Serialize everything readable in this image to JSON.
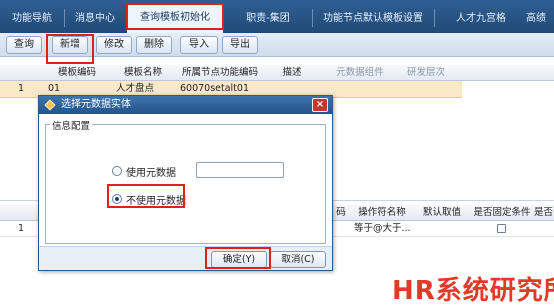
{
  "tabs": [
    "功能导航",
    "消息中心",
    "查询模板初始化",
    "职责-集团",
    "功能节点默认模板设置",
    "人才九宫格",
    "高绩"
  ],
  "toolbar": {
    "query": "查询",
    "add": "新增",
    "edit": "修改",
    "delete": "删除",
    "import": "导入",
    "export": "导出"
  },
  "grid1": {
    "headers": [
      "模板编码",
      "模板名称",
      "所属节点功能编码",
      "描述",
      "元数据组件",
      "研发层次"
    ],
    "row": {
      "num": "1",
      "code": "01",
      "name": "人才盘点",
      "node": "60070setalt01"
    }
  },
  "grid2": {
    "headers": [
      "码",
      "操作符名称",
      "默认取值",
      "是否固定条件",
      "是否..."
    ],
    "row": {
      "num": "1",
      "op": "等于@大于..."
    }
  },
  "dialog": {
    "title": "选择元数据实体",
    "legend": "信息配置",
    "opt_use": "使用元数据",
    "opt_nouse": "不使用元数据",
    "ok": "确定(Y)",
    "cancel": "取消(C)",
    "close": "×"
  },
  "watermark": "HR系统研究所",
  "colors": {
    "accent": "#e0201c",
    "title_bar": "#23538a",
    "selected_row": "#fbe8c8"
  }
}
